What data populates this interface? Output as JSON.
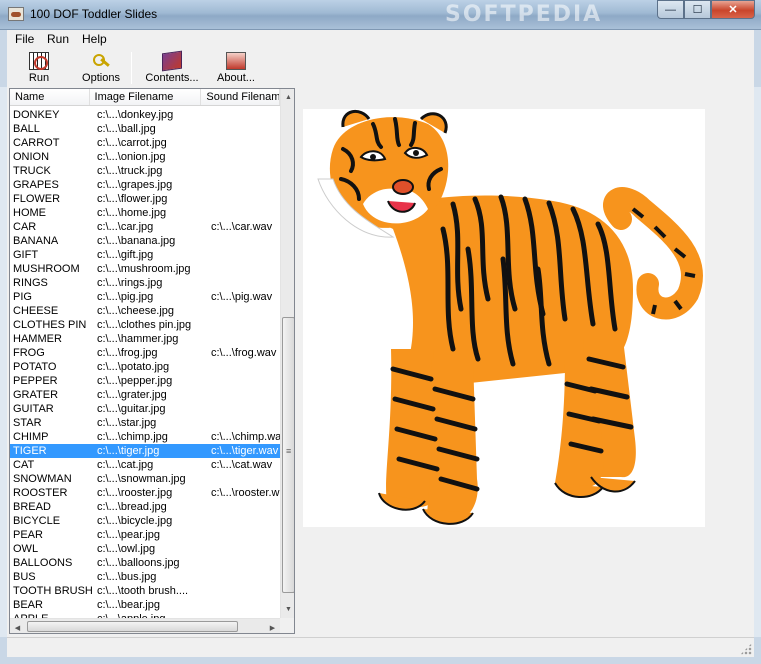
{
  "window": {
    "title": "100 DOF Toddler Slides",
    "watermark": "SOFTPEDIA"
  },
  "window_buttons": {
    "minimize": "—",
    "maximize": "☐",
    "close": "✕"
  },
  "menu": [
    "File",
    "Run",
    "Help"
  ],
  "toolbar": {
    "run": "Run",
    "options": "Options",
    "contents": "Contents...",
    "about": "About..."
  },
  "list": {
    "columns": [
      "Name",
      "Image Filename",
      "Sound Filename"
    ],
    "selected_index": 24,
    "rows": [
      [
        "DONKEY",
        "c:\\...\\donkey.jpg",
        ""
      ],
      [
        "BALL",
        "c:\\...\\ball.jpg",
        ""
      ],
      [
        "CARROT",
        "c:\\...\\carrot.jpg",
        ""
      ],
      [
        "ONION",
        "c:\\...\\onion.jpg",
        ""
      ],
      [
        "TRUCK",
        "c:\\...\\truck.jpg",
        ""
      ],
      [
        "GRAPES",
        "c:\\...\\grapes.jpg",
        ""
      ],
      [
        "FLOWER",
        "c:\\...\\flower.jpg",
        ""
      ],
      [
        "HOME",
        "c:\\...\\home.jpg",
        ""
      ],
      [
        "CAR",
        "c:\\...\\car.jpg",
        "c:\\...\\car.wav"
      ],
      [
        "BANANA",
        "c:\\...\\banana.jpg",
        ""
      ],
      [
        "GIFT",
        "c:\\...\\gift.jpg",
        ""
      ],
      [
        "MUSHROOM",
        "c:\\...\\mushroom.jpg",
        ""
      ],
      [
        "RINGS",
        "c:\\...\\rings.jpg",
        ""
      ],
      [
        "PIG",
        "c:\\...\\pig.jpg",
        "c:\\...\\pig.wav"
      ],
      [
        "CHEESE",
        "c:\\...\\cheese.jpg",
        ""
      ],
      [
        "CLOTHES PIN",
        "c:\\...\\clothes pin.jpg",
        ""
      ],
      [
        "HAMMER",
        "c:\\...\\hammer.jpg",
        ""
      ],
      [
        "FROG",
        "c:\\...\\frog.jpg",
        "c:\\...\\frog.wav"
      ],
      [
        "POTATO",
        "c:\\...\\potato.jpg",
        ""
      ],
      [
        "PEPPER",
        "c:\\...\\pepper.jpg",
        ""
      ],
      [
        "GRATER",
        "c:\\...\\grater.jpg",
        ""
      ],
      [
        "GUITAR",
        "c:\\...\\guitar.jpg",
        ""
      ],
      [
        "STAR",
        "c:\\...\\star.jpg",
        ""
      ],
      [
        "CHIMP",
        "c:\\...\\chimp.jpg",
        "c:\\...\\chimp.wav"
      ],
      [
        "TIGER",
        "c:\\...\\tiger.jpg",
        "c:\\...\\tiger.wav"
      ],
      [
        "CAT",
        "c:\\...\\cat.jpg",
        "c:\\...\\cat.wav"
      ],
      [
        "SNOWMAN",
        "c:\\...\\snowman.jpg",
        ""
      ],
      [
        "ROOSTER",
        "c:\\...\\rooster.jpg",
        "c:\\...\\rooster.wav"
      ],
      [
        "BREAD",
        "c:\\...\\bread.jpg",
        ""
      ],
      [
        "BICYCLE",
        "c:\\...\\bicycle.jpg",
        ""
      ],
      [
        "PEAR",
        "c:\\...\\pear.jpg",
        ""
      ],
      [
        "OWL",
        "c:\\...\\owl.jpg",
        ""
      ],
      [
        "BALLOONS",
        "c:\\...\\balloons.jpg",
        ""
      ],
      [
        "BUS",
        "c:\\...\\bus.jpg",
        ""
      ],
      [
        "TOOTH BRUSH",
        "c:\\...\\tooth brush....",
        ""
      ],
      [
        "BEAR",
        "c:\\...\\bear.jpg",
        ""
      ],
      [
        "APPLE",
        "c:\\...\\apple.jpg",
        ""
      ]
    ]
  },
  "colors": {
    "selection": "#3399ff",
    "tiger_orange": "#f7941d",
    "stripe": "#111111"
  }
}
